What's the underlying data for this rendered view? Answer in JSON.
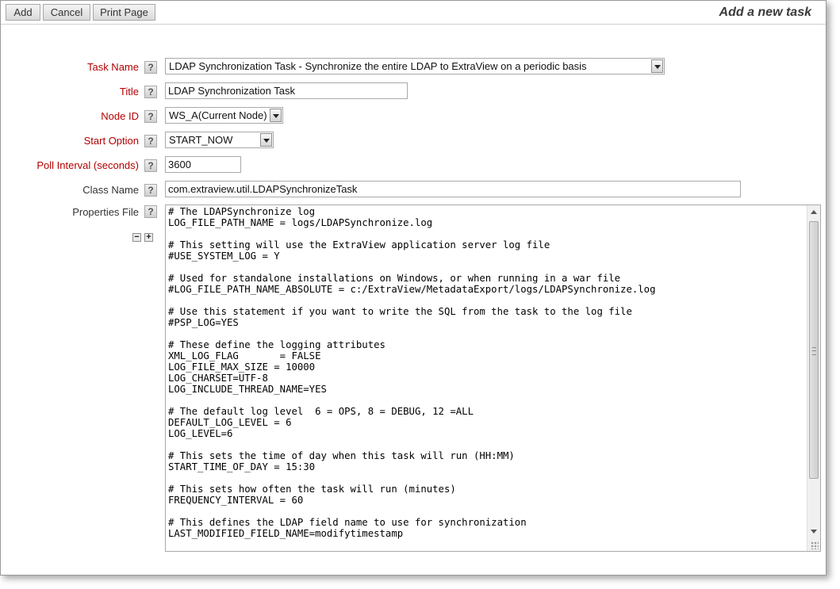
{
  "toolbar": {
    "add_label": "Add",
    "cancel_label": "Cancel",
    "print_label": "Print Page",
    "page_title": "Add a new task"
  },
  "form": {
    "task_name": {
      "label": "Task Name",
      "value": "LDAP Synchronization Task - Synchronize the entire LDAP to ExtraView on a periodic basis"
    },
    "title": {
      "label": "Title",
      "value": "LDAP Synchronization Task"
    },
    "node_id": {
      "label": "Node ID",
      "value": "WS_A(Current Node)"
    },
    "start_option": {
      "label": "Start Option",
      "value": "START_NOW"
    },
    "poll_interval": {
      "label": "Poll Interval (seconds)",
      "value": "3600"
    },
    "class_name": {
      "label": "Class Name",
      "value": "com.extraview.util.LDAPSynchronizeTask"
    },
    "properties_file": {
      "label": "Properties File",
      "content": "# The LDAPSynchronize log\nLOG_FILE_PATH_NAME = logs/LDAPSynchronize.log\n\n# This setting will use the ExtraView application server log file\n#USE_SYSTEM_LOG = Y\n\n# Used for standalone installations on Windows, or when running in a war file\n#LOG_FILE_PATH_NAME_ABSOLUTE = c:/ExtraView/MetadataExport/logs/LDAPSynchronize.log\n\n# Use this statement if you want to write the SQL from the task to the log file\n#PSP_LOG=YES\n\n# These define the logging attributes\nXML_LOG_FLAG       = FALSE\nLOG_FILE_MAX_SIZE = 10000\nLOG_CHARSET=UTF-8\nLOG_INCLUDE_THREAD_NAME=YES\n\n# The default log level  6 = OPS, 8 = DEBUG, 12 =ALL\nDEFAULT_LOG_LEVEL = 6\nLOG_LEVEL=6\n\n# This sets the time of day when this task will run (HH:MM)\nSTART_TIME_OF_DAY = 15:30\n\n# This sets how often the task will run (minutes)\nFREQUENCY_INTERVAL = 60\n\n# This defines the LDAP field name to use for synchronization\nLAST_MODIFIED_FIELD_NAME=modifytimestamp"
    }
  },
  "icons": {
    "help": "?",
    "minus": "−",
    "plus": "+"
  }
}
